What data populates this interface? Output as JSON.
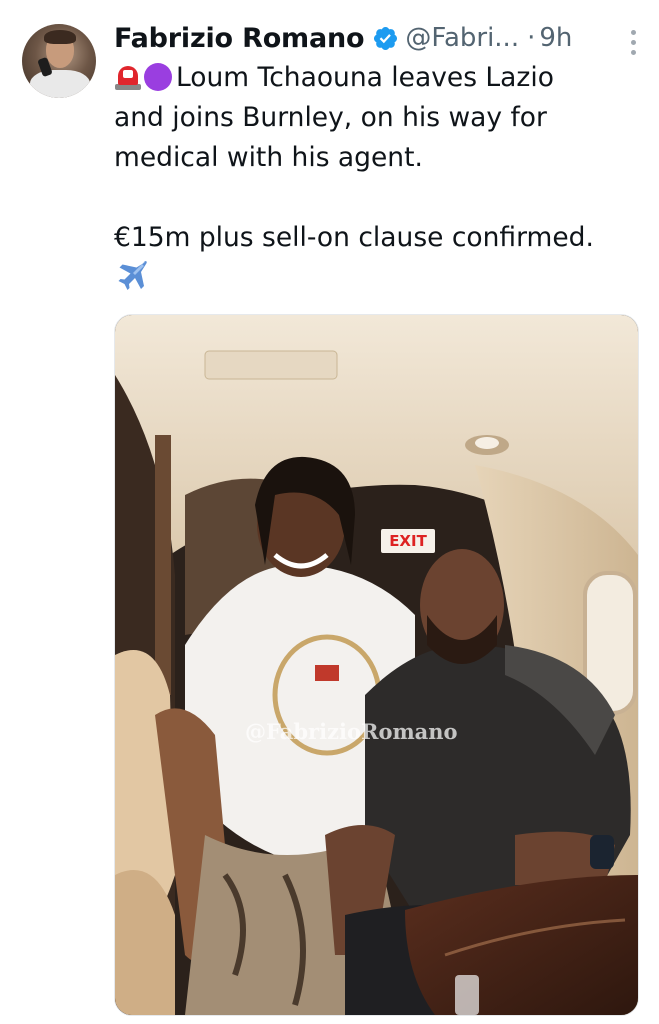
{
  "tweet": {
    "author_name": "Fabrizio Romano",
    "handle": "@Fabri...",
    "separator": "·",
    "time": "9h",
    "verified": true,
    "text_lines": [
      "Loum Tchaouna leaves Lazio",
      "and joins Burnley, on his way for",
      "medical with his agent.",
      "",
      "€15m plus sell-on clause confirmed."
    ],
    "emojis": [
      "police-siren-emoji",
      "purple-circle-emoji",
      "airplane-emoji"
    ]
  },
  "media": {
    "watermark": "@FabrizioRomano",
    "sign_text": "EXIT"
  },
  "colors": {
    "text": "#0f1419",
    "secondary": "#536471",
    "verified": "#1d9bf0",
    "purple": "#9a3ee0",
    "siren": "#e0262d"
  }
}
